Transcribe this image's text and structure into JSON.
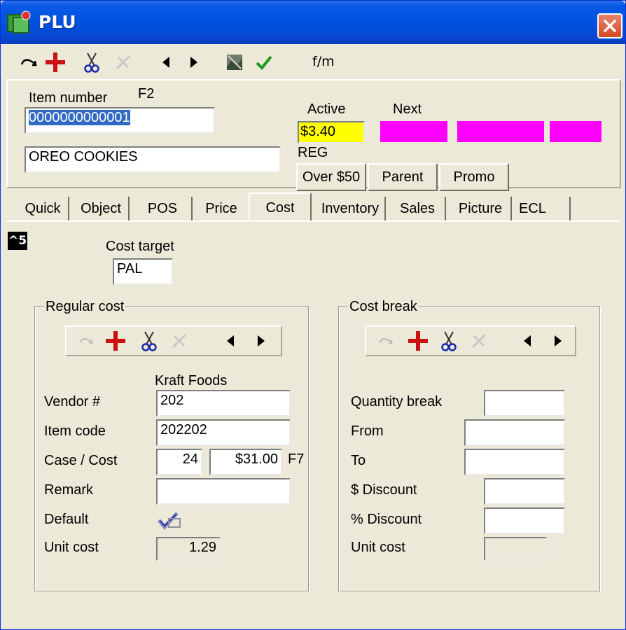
{
  "window": {
    "title": "PLU"
  },
  "toolbar": {
    "icons": [
      "undo-icon",
      "add-icon",
      "cut-icon",
      "delete-icon",
      "previous-icon",
      "next-icon",
      "image-icon",
      "confirm-icon"
    ],
    "text": "f/m"
  },
  "header": {
    "item_number_label": "Item number",
    "item_number_shortcut": "F2",
    "item_number_value": "0000000000001",
    "description_value": "OREO COOKIES",
    "active_label": "Active",
    "next_label": "Next",
    "active_price": "$3.40",
    "price_type": "REG",
    "buttons": [
      "Over $50",
      "Parent",
      "Promo"
    ],
    "colors": {
      "active_highlight": "#ffff00",
      "next_swatch": "#ff00ff"
    }
  },
  "tabs": [
    "Quick",
    "Object",
    "POS",
    "Price",
    "Cost",
    "Inventory",
    "Sales",
    "Picture",
    "ECL"
  ],
  "active_tab": "Cost",
  "cost": {
    "shortcut_badge": "^5",
    "cost_target_label": "Cost target",
    "cost_target_value": "PAL",
    "regular_cost": {
      "title": "Regular cost",
      "vendor_name": "Kraft Foods",
      "vendor_label": "Vendor #",
      "vendor_value": "202",
      "item_code_label": "Item code",
      "item_code_value": "202202",
      "case_cost_label": "Case / Cost",
      "case_value": "24",
      "cost_value": "$31.00",
      "cost_shortcut": "F7",
      "remark_label": "Remark",
      "remark_value": "",
      "default_label": "Default",
      "default_checked": true,
      "unit_cost_label": "Unit cost",
      "unit_cost_value": "1.29"
    },
    "cost_break": {
      "title": "Cost break",
      "quantity_break_label": "Quantity break",
      "from_label": "From",
      "to_label": "To",
      "dollar_discount_label": "$ Discount",
      "percent_discount_label": "% Discount",
      "unit_cost_label": "Unit cost"
    }
  }
}
